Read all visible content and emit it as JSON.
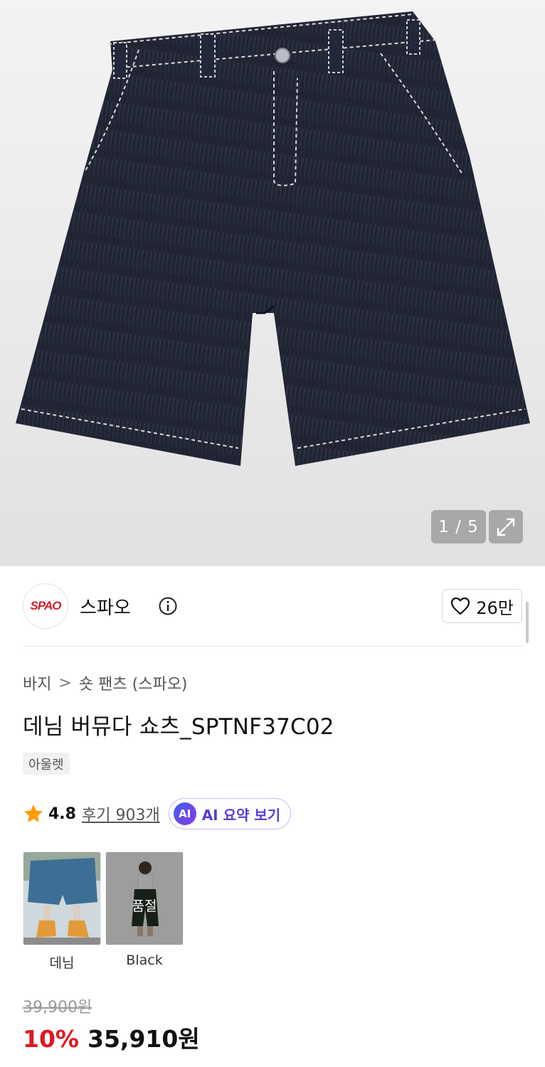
{
  "gallery": {
    "image_alt": "데님 버뮤다 쇼츠",
    "counter": "1 / 5",
    "icons": {
      "expand": "expand-icon"
    }
  },
  "brand": {
    "logo_text": "SPAO",
    "name": "스파오",
    "info_icon": "info-icon",
    "like_icon": "heart-icon",
    "like_count": "26만",
    "logo_color": "#d0202a"
  },
  "breadcrumb": {
    "items": [
      "바지",
      "숏 팬츠 (스파오)"
    ],
    "separator": ">"
  },
  "product": {
    "title": "데님 버뮤다 쇼츠_SPTNF37C02",
    "tag": "아울렛"
  },
  "rating": {
    "star_icon": "star-icon",
    "value": "4.8",
    "reviews": "후기 903개",
    "ai_badge": "AI",
    "ai_label": "AI 요약 보기"
  },
  "options": [
    {
      "label": "데님",
      "soldout": ""
    },
    {
      "label": "Black",
      "soldout": "품절"
    }
  ],
  "price": {
    "original": "39,900원",
    "discount": "10%",
    "final": "35,910원",
    "discount_color": "#e0161f"
  }
}
